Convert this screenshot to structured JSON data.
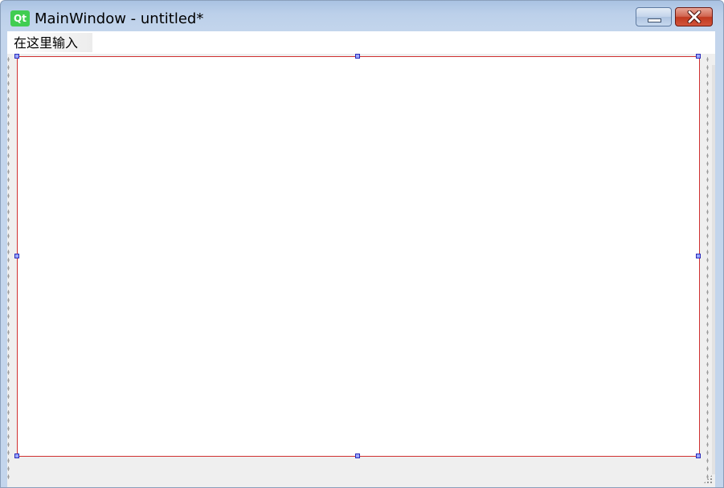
{
  "window": {
    "title": "MainWindow - untitled*",
    "app_icon_text": "Qt",
    "app_icon_color": "#41cd52"
  },
  "title_buttons": {
    "minimize_icon": "minimize-icon",
    "close_icon": "close-icon",
    "close_color": "#c0391f"
  },
  "menubar": {
    "items": [
      {
        "label": "在这里输入"
      }
    ]
  },
  "canvas": {
    "selection_border_color": "#d03030",
    "handle_color": "#2a2ab8"
  }
}
